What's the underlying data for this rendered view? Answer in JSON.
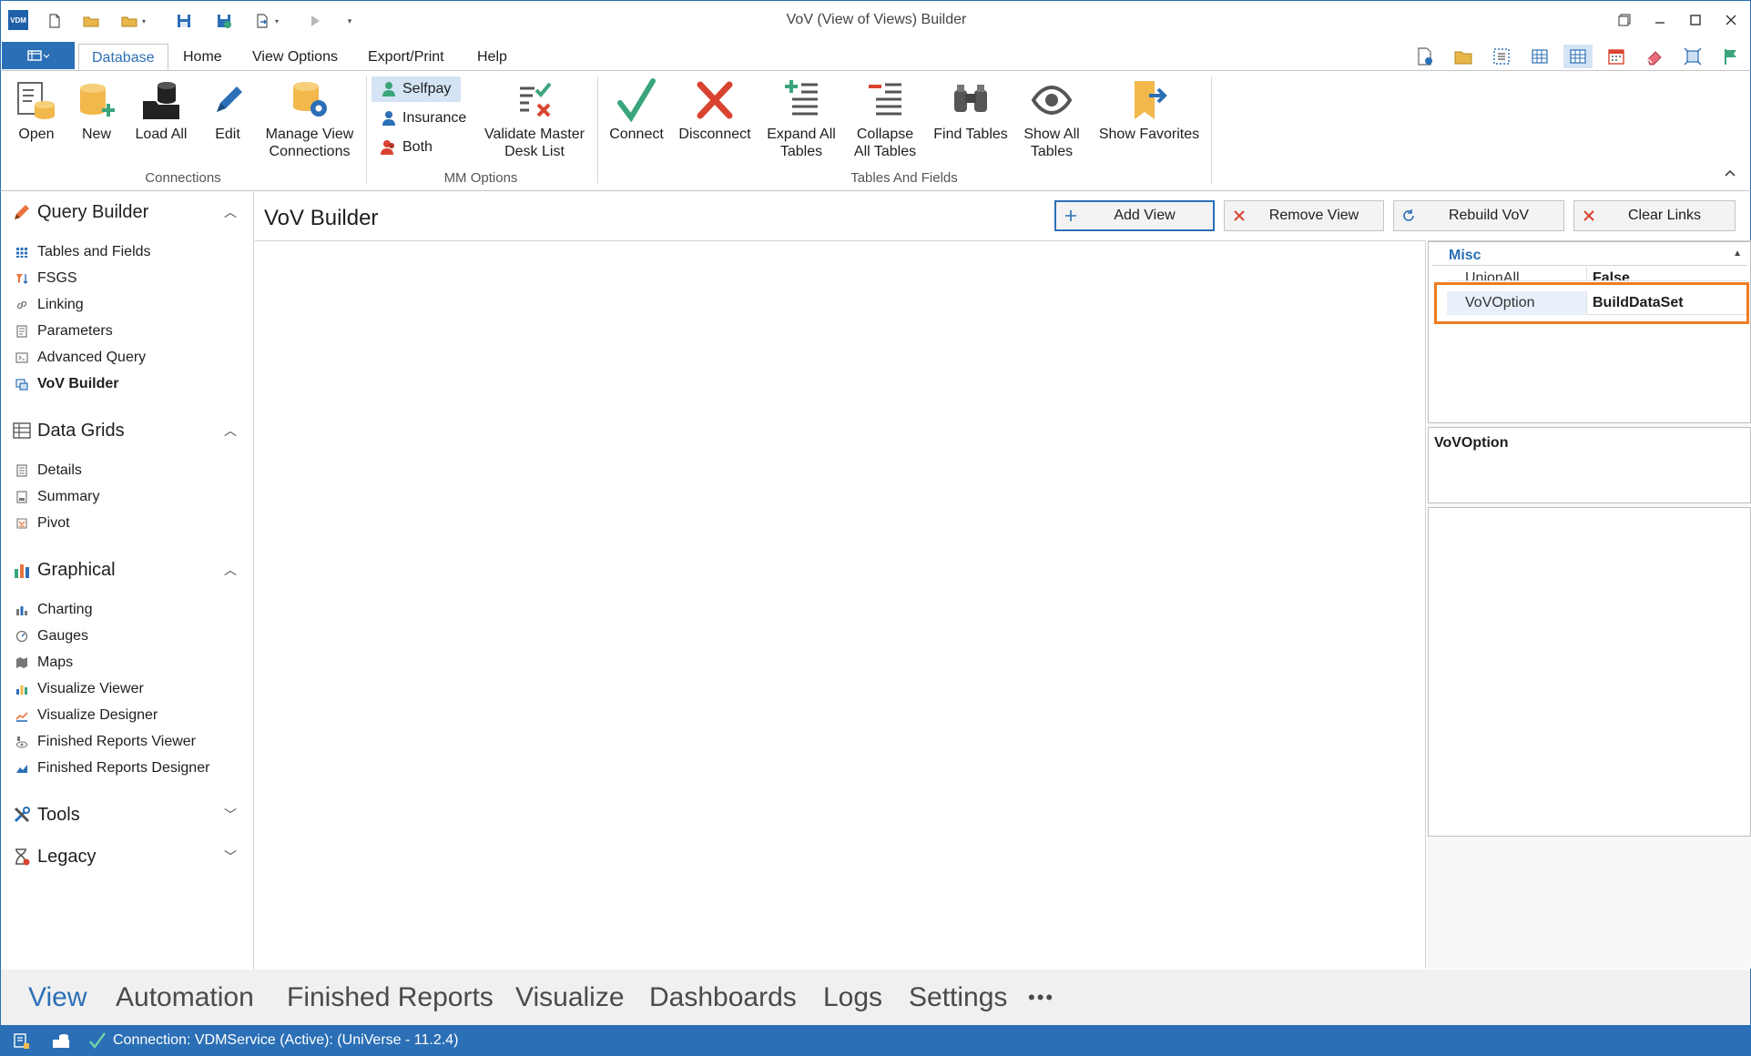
{
  "window": {
    "title": "VoV (View of Views) Builder",
    "logo_text": "VDM",
    "controls": [
      "restore-down-icon",
      "minimize-icon",
      "maximize-icon",
      "close-icon"
    ]
  },
  "ribbon_tabs": [
    {
      "label": "Database",
      "active": true
    },
    {
      "label": "Home"
    },
    {
      "label": "View Options"
    },
    {
      "label": "Export/Print"
    },
    {
      "label": "Help"
    }
  ],
  "ribbon": {
    "connections": {
      "label": "Connections",
      "buttons": [
        {
          "label": "Open",
          "icon": "open-connection-icon"
        },
        {
          "label": "New",
          "icon": "new-connection-icon"
        },
        {
          "label": "Load All",
          "icon": "load-all-icon"
        },
        {
          "label": "Edit",
          "icon": "edit-pencil-icon"
        },
        {
          "label": "Manage View Connections",
          "line1": "Manage View",
          "line2": "Connections",
          "icon": "manage-connections-icon"
        }
      ]
    },
    "mm_options": {
      "label": "MM Options",
      "options": [
        {
          "label": "Selfpay",
          "selected": true
        },
        {
          "label": "Insurance"
        },
        {
          "label": "Both"
        }
      ],
      "validate": {
        "line1": "Validate Master",
        "line2": "Desk List"
      }
    },
    "tables_and_fields": {
      "label": "Tables And Fields",
      "buttons": [
        {
          "label": "Connect",
          "icon": "checkmark-icon"
        },
        {
          "label": "Disconnect",
          "icon": "red-x-icon"
        },
        {
          "line1": "Expand All",
          "line2": "Tables",
          "icon": "expand-all-icon"
        },
        {
          "line1": "Collapse",
          "line2": "All Tables",
          "icon": "collapse-all-icon"
        },
        {
          "label": "Find Tables",
          "icon": "binoculars-icon"
        },
        {
          "line1": "Show All",
          "line2": "Tables",
          "icon": "eye-icon"
        },
        {
          "label": "Show Favorites",
          "icon": "favorites-icon"
        }
      ]
    }
  },
  "sidebar": {
    "sections": [
      {
        "title": "Query Builder",
        "expanded": true,
        "items": [
          {
            "label": "Tables and Fields"
          },
          {
            "label": "FSGS"
          },
          {
            "label": "Linking"
          },
          {
            "label": "Parameters"
          },
          {
            "label": "Advanced Query"
          },
          {
            "label": "VoV Builder",
            "active": true
          }
        ]
      },
      {
        "title": "Data Grids",
        "expanded": true,
        "items": [
          {
            "label": "Details"
          },
          {
            "label": "Summary"
          },
          {
            "label": "Pivot"
          }
        ]
      },
      {
        "title": "Graphical",
        "expanded": true,
        "items": [
          {
            "label": "Charting"
          },
          {
            "label": "Gauges"
          },
          {
            "label": "Maps"
          },
          {
            "label": "Visualize Viewer"
          },
          {
            "label": "Visualize Designer"
          },
          {
            "label": "Finished Reports Viewer"
          },
          {
            "label": "Finished Reports Designer"
          }
        ]
      },
      {
        "title": "Tools",
        "expanded": false
      },
      {
        "title": "Legacy",
        "expanded": false
      }
    ]
  },
  "main": {
    "title": "VoV Builder",
    "actions": [
      {
        "label": "Add View",
        "icon": "plus-icon"
      },
      {
        "label": "Remove View",
        "icon": "x-icon"
      },
      {
        "label": "Rebuild VoV",
        "icon": "refresh-icon"
      },
      {
        "label": "Clear Links",
        "icon": "x-icon"
      }
    ]
  },
  "property_grid": {
    "category": "Misc",
    "rows": [
      {
        "key": "UnionAll",
        "value": "False"
      },
      {
        "key": "VoVOption",
        "value": "BuildDataSet",
        "selected": true
      }
    ],
    "description_title": "VoVOption"
  },
  "bottom_nav": [
    {
      "label": "View",
      "active": true
    },
    {
      "label": "Automation"
    },
    {
      "label": "Finished Reports"
    },
    {
      "label": "Visualize"
    },
    {
      "label": "Dashboards"
    },
    {
      "label": "Logs"
    },
    {
      "label": "Settings"
    },
    {
      "label": "•••"
    }
  ],
  "status": {
    "connection_text": "Connection: VDMService (Active): (UniVerse - 11.2.4)"
  },
  "colors": {
    "accent": "#2b6fb6",
    "highlight_box": "#f07c22",
    "connect_green": "#3aa57a",
    "disconnect_red": "#d9432f"
  }
}
